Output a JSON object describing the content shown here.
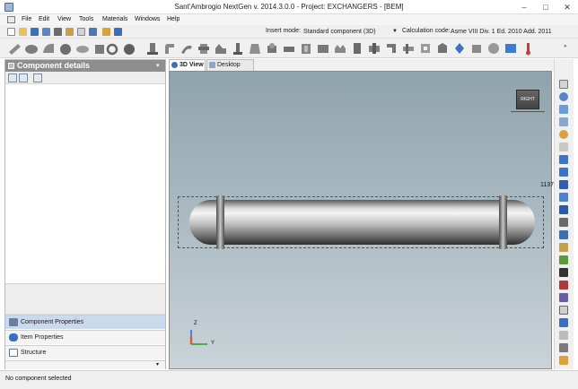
{
  "window": {
    "title": "Sant'Ambrogio NextGen  v. 2014.3.0.0 - Project: EXCHANGERS - [BEM]",
    "minimize_glyph": "–",
    "maximize_glyph": "□",
    "close_glyph": "✕"
  },
  "menu": [
    "File",
    "Edit",
    "View",
    "Tools",
    "Materials",
    "Windows",
    "Help"
  ],
  "toolbar": {
    "insert_mode_label": "Insert mode:",
    "insert_mode_value": "Standard component (3D)",
    "calculation_code_label": "Calculation code:",
    "calculation_code_value": "Asme VIII Div. 1 Ed. 2010 Add. 2011",
    "dropdown_glyph": "▼"
  },
  "left_panel": {
    "title": "Component details",
    "pin_glyph": "▾",
    "nav": [
      {
        "label": "Component Properties",
        "active": true,
        "color": "#6b7ea0"
      },
      {
        "label": "Item Properties",
        "active": false,
        "color": "#3b6fbf"
      },
      {
        "label": "Structure",
        "active": false,
        "color": "#4a7ac4"
      }
    ],
    "overflow_glyph": "▾"
  },
  "tabs": [
    {
      "label": "3D View",
      "active": true,
      "icon": "cube-icon"
    },
    {
      "label": "Desktop View",
      "active": false,
      "icon": "desktop-icon"
    }
  ],
  "viewport": {
    "dimension_label": "1137",
    "view_cube_label": "RIGHT",
    "axis_z": "Z",
    "axis_y": "Y"
  },
  "status": {
    "text": "No component selected"
  },
  "colors": {
    "panel_header": "#8e8e8e",
    "active_nav": "#c9d9ee",
    "viewport_top": "#8fa3ad",
    "viewport_bottom": "#c9d3d8",
    "axis_x": "#e05a2a",
    "axis_z": "#2a6ad6",
    "axis_y": "#2a9a2a"
  }
}
